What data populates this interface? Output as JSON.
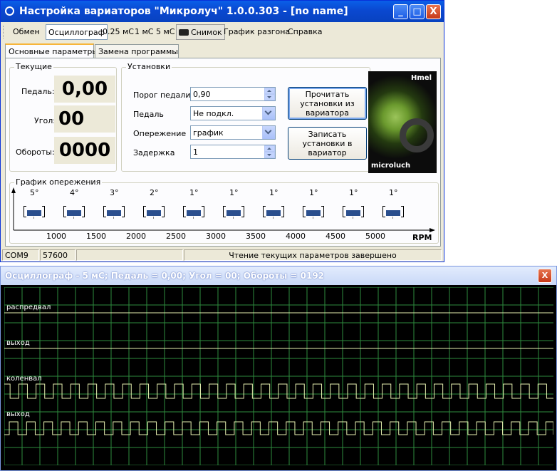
{
  "main_window": {
    "title": "Настройка вариаторов \"Микролуч\" 1.0.0.303 - [no name]",
    "controls": {
      "minimize": "_",
      "maximize": "□",
      "close": "X"
    }
  },
  "menu": {
    "exchange": "Обмен",
    "oscilloscope": "Осциллограф",
    "rate1": "0.25 мС",
    "rate2": "1 мС",
    "rate3": "5 мС",
    "snapshot": "Снимок",
    "accel_graph": "График разгона",
    "help": "Справка"
  },
  "tabs": {
    "main": "Основные параметры",
    "replace": "Замена программы"
  },
  "current": {
    "group_label": "Текущие",
    "pedal_label": "Педаль:",
    "pedal_value": "0,00",
    "angle_label": "Угол:",
    "angle_value": "00",
    "rpm_label": "Обороты:",
    "rpm_value": "0000"
  },
  "settings": {
    "group_label": "Установки",
    "threshold_label": "Порог педали",
    "threshold_value": "0,90",
    "pedal_label": "Педаль",
    "pedal_value": "Не подкл.",
    "advance_label": "Опережение",
    "advance_value": "график",
    "delay_label": "Задержка",
    "delay_value": "1",
    "read_button": "Прочитать установки из вариатора",
    "write_button": "Записать установки в вариатор"
  },
  "logo": {
    "text_top": "Hmel",
    "text_bottom": "microluch"
  },
  "advance_graph": {
    "group_label": "График опережения",
    "angles": [
      "5°",
      "4°",
      "3°",
      "2°",
      "1°",
      "1°",
      "1°",
      "1°",
      "1°",
      "1°"
    ],
    "rpm_ticks": [
      "1000",
      "1500",
      "2000",
      "2500",
      "3000",
      "3500",
      "4000",
      "4500",
      "5000"
    ],
    "axis_label": "RPM"
  },
  "status": {
    "port": "COM9",
    "baud": "57600",
    "message": "Чтение текущих параметров завершено"
  },
  "oscilloscope": {
    "title": "Осциллограф - 5 мС; Педаль = 0,00; Угол = 00; Обороты = 0192",
    "close": "X",
    "channels": [
      "распредвал",
      "выход",
      "коленвал",
      "выход"
    ],
    "colors": {
      "grid": "#2e8b3e",
      "trace": "#e6f0b0",
      "background": "#000000"
    }
  }
}
